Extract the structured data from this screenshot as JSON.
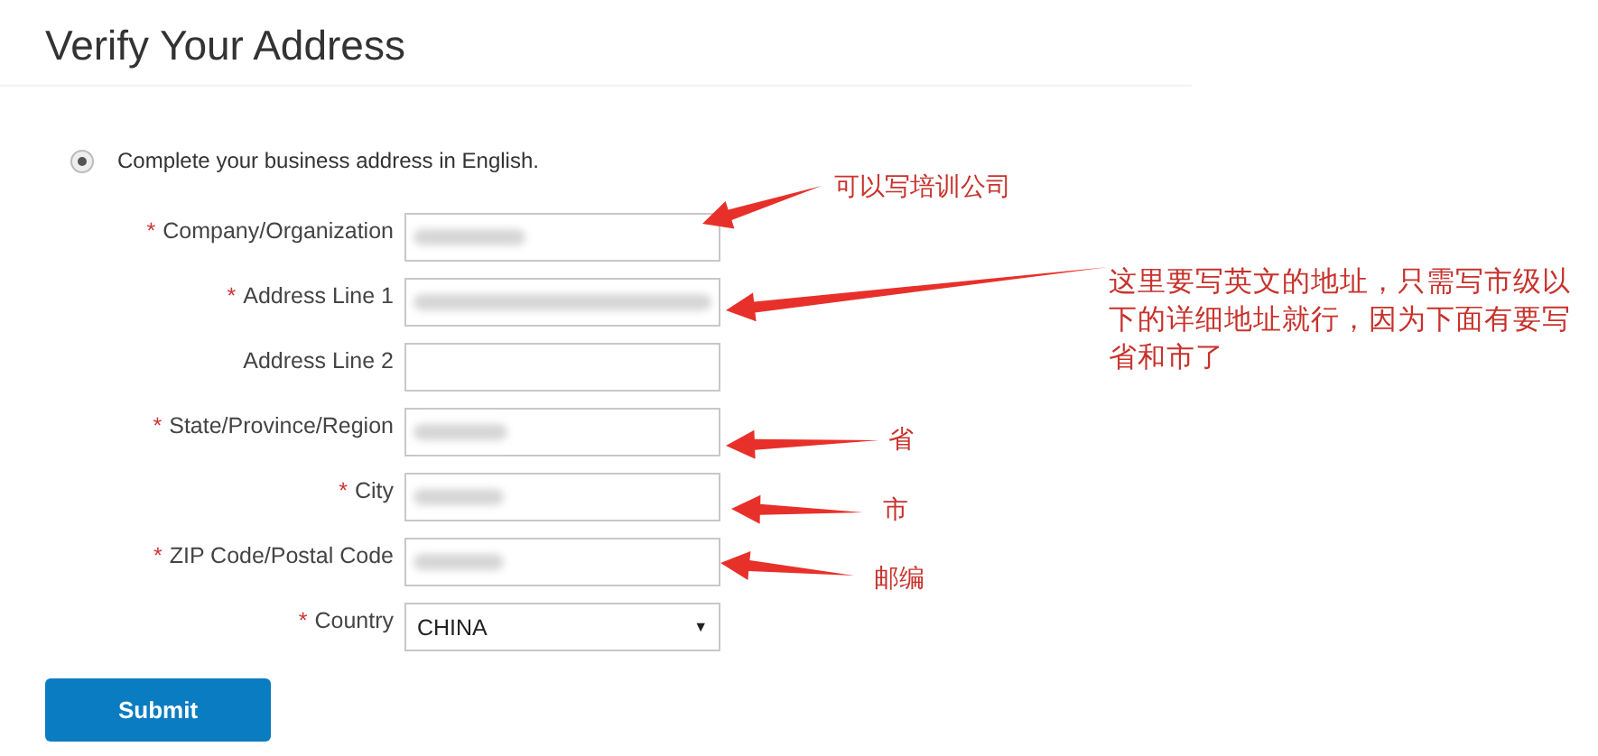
{
  "page": {
    "title": "Verify Your Address"
  },
  "option": {
    "label": "Complete your business address in English.",
    "selected": true
  },
  "fields": [
    {
      "kind": "text",
      "required_mark": "*",
      "label": "Company/Organization",
      "blurred": true
    },
    {
      "kind": "text",
      "required_mark": "*",
      "label": "Address Line 1",
      "blurred": true
    },
    {
      "kind": "text",
      "label": "Address Line 2",
      "blurred": false
    },
    {
      "kind": "text",
      "required_mark": "*",
      "label": "State/Province/Region",
      "blurred": true
    },
    {
      "kind": "text",
      "required_mark": "*",
      "label": "City",
      "blurred": true
    },
    {
      "kind": "text",
      "required_mark": "*",
      "label": "ZIP Code/Postal Code",
      "blurred": true
    },
    {
      "kind": "select",
      "required_mark": "*",
      "label": "Country",
      "value": "CHINA",
      "caret": "▼"
    }
  ],
  "submit": "Submit",
  "annotations": [
    {
      "text": "可以写培训公司"
    },
    {
      "text": "这里要写英文的地址，只需写市级以下的详细地址就行，因为下面有要写省和市了"
    },
    {
      "text": "省"
    },
    {
      "text": "市"
    },
    {
      "text": "邮编"
    }
  ]
}
